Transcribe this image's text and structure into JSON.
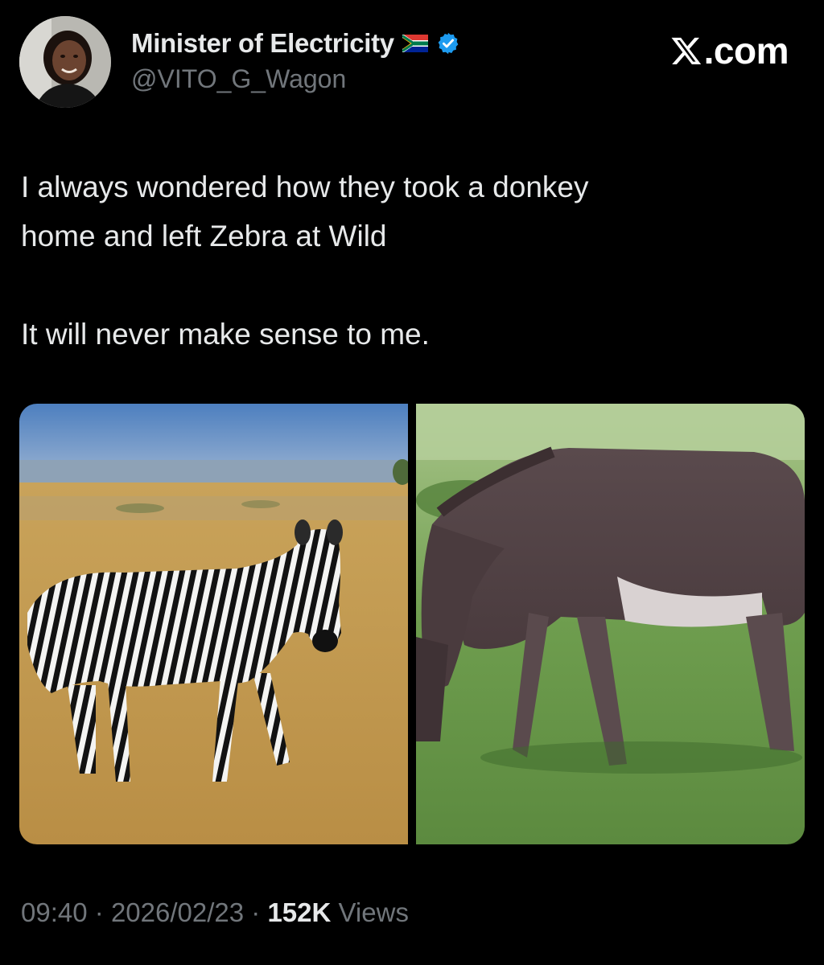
{
  "author": {
    "display_name": "Minister of Electricity",
    "handle": "@VITO_G_Wagon",
    "flag_icon": "south-africa-flag-icon",
    "verified_icon": "verified-badge-icon",
    "verified_color": "#1d9bf0"
  },
  "brand": {
    "logo_icon": "x-logo-icon",
    "suffix": ".com"
  },
  "tweet": {
    "line1": "I always wondered how they took a donkey",
    "line2": "home and left Zebra at Wild",
    "line3": "It will never make sense to me."
  },
  "media": [
    {
      "subject": "zebra"
    },
    {
      "subject": "donkey"
    }
  ],
  "meta": {
    "time": "09:40",
    "separator": "·",
    "date": "2026/02/23",
    "views_count": "152K",
    "views_label": "Views"
  },
  "colors": {
    "background": "#000000",
    "primary_text": "#e7e9ea",
    "secondary_text": "#71767b"
  }
}
